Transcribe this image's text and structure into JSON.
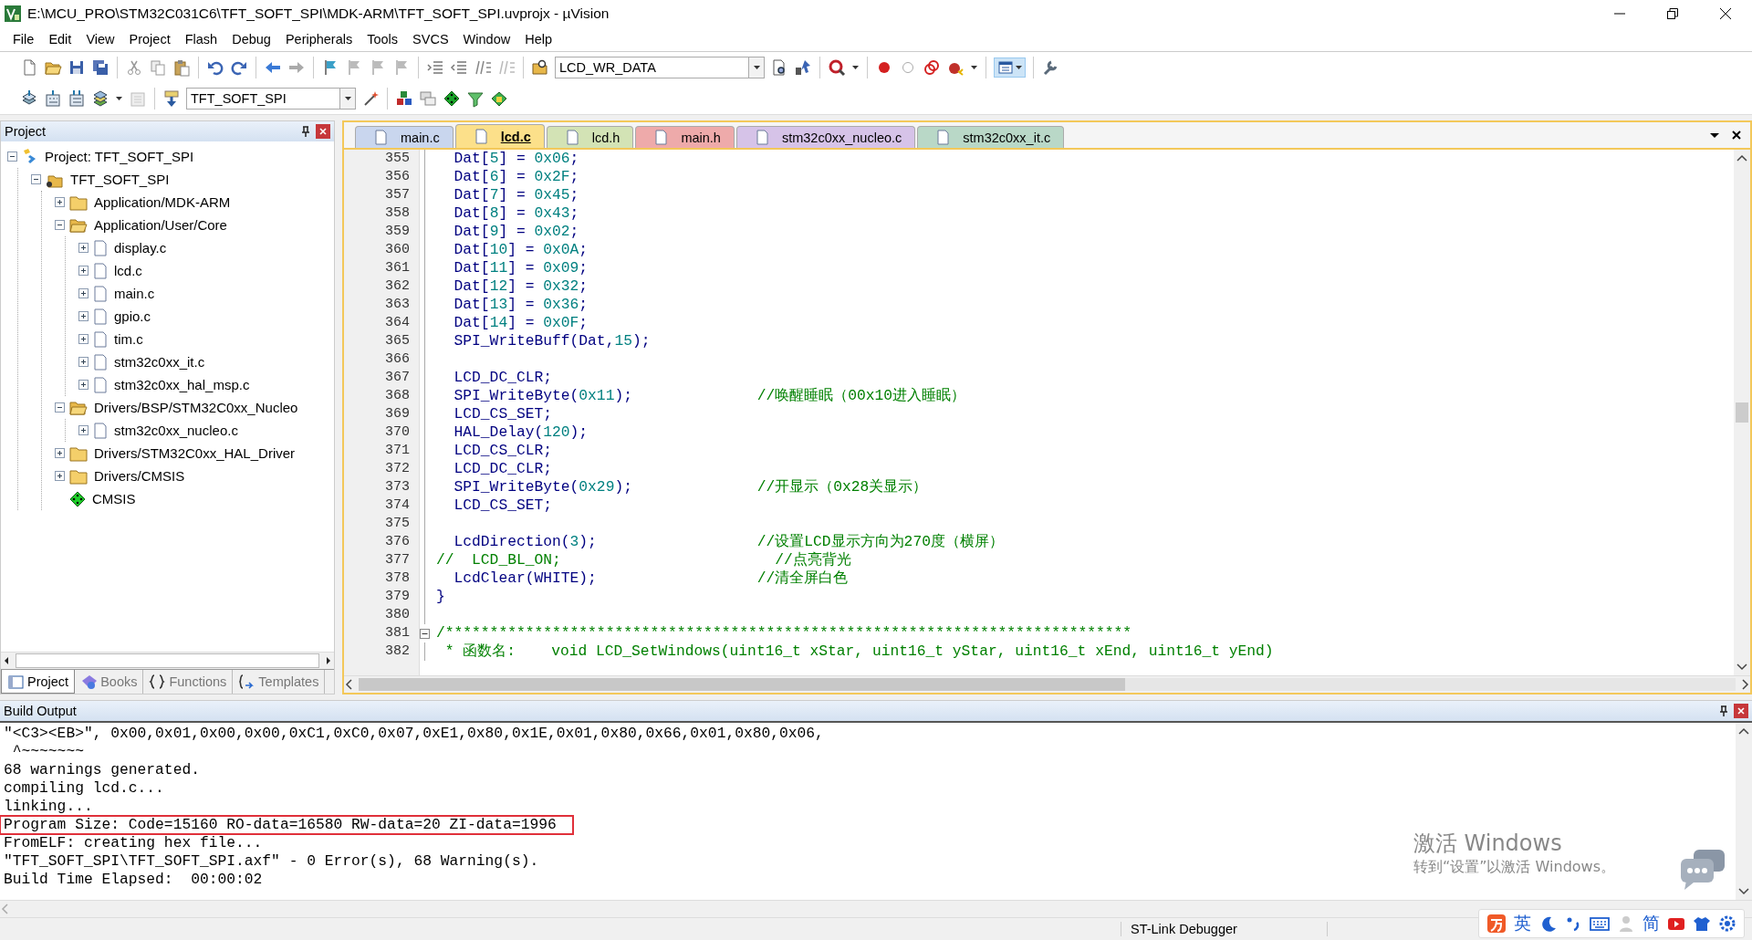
{
  "window": {
    "title": "E:\\MCU_PRO\\STM32C031C6\\TFT_SOFT_SPI\\MDK-ARM\\TFT_SOFT_SPI.uvprojx - µVision"
  },
  "menu": [
    "File",
    "Edit",
    "View",
    "Project",
    "Flash",
    "Debug",
    "Peripherals",
    "Tools",
    "SVCS",
    "Window",
    "Help"
  ],
  "toolbar": {
    "find_combo": "LCD_WR_DATA",
    "target_combo": "TFT_SOFT_SPI"
  },
  "project_panel": {
    "title": "Project",
    "tree": [
      {
        "label": "Project: TFT_SOFT_SPI",
        "kind": "project",
        "expanded": true,
        "children": [
          {
            "label": "TFT_SOFT_SPI",
            "kind": "target",
            "expanded": true,
            "children": [
              {
                "label": "Application/MDK-ARM",
                "kind": "folder",
                "expanded": false
              },
              {
                "label": "Application/User/Core",
                "kind": "folder",
                "expanded": true,
                "children": [
                  {
                    "label": "display.c",
                    "kind": "file",
                    "expanded": false
                  },
                  {
                    "label": "lcd.c",
                    "kind": "file",
                    "expanded": false
                  },
                  {
                    "label": "main.c",
                    "kind": "file",
                    "expanded": false
                  },
                  {
                    "label": "gpio.c",
                    "kind": "file",
                    "expanded": false
                  },
                  {
                    "label": "tim.c",
                    "kind": "file",
                    "expanded": false
                  },
                  {
                    "label": "stm32c0xx_it.c",
                    "kind": "file",
                    "expanded": false
                  },
                  {
                    "label": "stm32c0xx_hal_msp.c",
                    "kind": "file",
                    "expanded": false
                  }
                ]
              },
              {
                "label": "Drivers/BSP/STM32C0xx_Nucleo",
                "kind": "folder",
                "expanded": true,
                "children": [
                  {
                    "label": "stm32c0xx_nucleo.c",
                    "kind": "file",
                    "expanded": false
                  }
                ]
              },
              {
                "label": "Drivers/STM32C0xx_HAL_Driver",
                "kind": "folder",
                "expanded": false
              },
              {
                "label": "Drivers/CMSIS",
                "kind": "folder",
                "expanded": false
              },
              {
                "label": "CMSIS",
                "kind": "component"
              }
            ]
          }
        ]
      }
    ],
    "tabs": [
      {
        "label": "Project",
        "kind": "project",
        "selected": true
      },
      {
        "label": "Books",
        "kind": "books",
        "selected": false
      },
      {
        "label": "Functions",
        "kind": "functions",
        "selected": false
      },
      {
        "label": "Templates",
        "kind": "templates",
        "selected": false
      }
    ]
  },
  "editor_tabs": [
    {
      "label": "main.c",
      "color": "#c9d6ee",
      "selected": false
    },
    {
      "label": "lcd.c",
      "color": "#fce08a",
      "selected": true
    },
    {
      "label": "lcd.h",
      "color": "#d3e3b5",
      "selected": false
    },
    {
      "label": "main.h",
      "color": "#eeaaaa",
      "selected": false
    },
    {
      "label": "stm32c0xx_nucleo.c",
      "color": "#d6c3e8",
      "selected": false
    },
    {
      "label": "stm32c0xx_it.c",
      "color": "#b9d8c7",
      "selected": false
    }
  ],
  "code_lines": [
    {
      "number": "355",
      "segments": [
        {
          "kind": "plain",
          "text": "  Dat["
        },
        {
          "kind": "number",
          "text": "5"
        },
        {
          "kind": "plain",
          "text": "] = "
        },
        {
          "kind": "number",
          "text": "0x06"
        },
        {
          "kind": "plain",
          "text": ";"
        }
      ]
    },
    {
      "number": "356",
      "segments": [
        {
          "kind": "plain",
          "text": "  Dat["
        },
        {
          "kind": "number",
          "text": "6"
        },
        {
          "kind": "plain",
          "text": "] = "
        },
        {
          "kind": "number",
          "text": "0x2F"
        },
        {
          "kind": "plain",
          "text": ";"
        }
      ]
    },
    {
      "number": "357",
      "segments": [
        {
          "kind": "plain",
          "text": "  Dat["
        },
        {
          "kind": "number",
          "text": "7"
        },
        {
          "kind": "plain",
          "text": "] = "
        },
        {
          "kind": "number",
          "text": "0x45"
        },
        {
          "kind": "plain",
          "text": ";"
        }
      ]
    },
    {
      "number": "358",
      "segments": [
        {
          "kind": "plain",
          "text": "  Dat["
        },
        {
          "kind": "number",
          "text": "8"
        },
        {
          "kind": "plain",
          "text": "] = "
        },
        {
          "kind": "number",
          "text": "0x43"
        },
        {
          "kind": "plain",
          "text": ";"
        }
      ]
    },
    {
      "number": "359",
      "segments": [
        {
          "kind": "plain",
          "text": "  Dat["
        },
        {
          "kind": "number",
          "text": "9"
        },
        {
          "kind": "plain",
          "text": "] = "
        },
        {
          "kind": "number",
          "text": "0x02"
        },
        {
          "kind": "plain",
          "text": ";"
        }
      ]
    },
    {
      "number": "360",
      "segments": [
        {
          "kind": "plain",
          "text": "  Dat["
        },
        {
          "kind": "number",
          "text": "10"
        },
        {
          "kind": "plain",
          "text": "] = "
        },
        {
          "kind": "number",
          "text": "0x0A"
        },
        {
          "kind": "plain",
          "text": ";"
        }
      ]
    },
    {
      "number": "361",
      "segments": [
        {
          "kind": "plain",
          "text": "  Dat["
        },
        {
          "kind": "number",
          "text": "11"
        },
        {
          "kind": "plain",
          "text": "] = "
        },
        {
          "kind": "number",
          "text": "0x09"
        },
        {
          "kind": "plain",
          "text": ";"
        }
      ]
    },
    {
      "number": "362",
      "segments": [
        {
          "kind": "plain",
          "text": "  Dat["
        },
        {
          "kind": "number",
          "text": "12"
        },
        {
          "kind": "plain",
          "text": "] = "
        },
        {
          "kind": "number",
          "text": "0x32"
        },
        {
          "kind": "plain",
          "text": ";"
        }
      ]
    },
    {
      "number": "363",
      "segments": [
        {
          "kind": "plain",
          "text": "  Dat["
        },
        {
          "kind": "number",
          "text": "13"
        },
        {
          "kind": "plain",
          "text": "] = "
        },
        {
          "kind": "number",
          "text": "0x36"
        },
        {
          "kind": "plain",
          "text": ";"
        }
      ]
    },
    {
      "number": "364",
      "segments": [
        {
          "kind": "plain",
          "text": "  Dat["
        },
        {
          "kind": "number",
          "text": "14"
        },
        {
          "kind": "plain",
          "text": "] = "
        },
        {
          "kind": "number",
          "text": "0x0F"
        },
        {
          "kind": "plain",
          "text": ";"
        }
      ]
    },
    {
      "number": "365",
      "segments": [
        {
          "kind": "plain",
          "text": "  SPI_WriteBuff(Dat,"
        },
        {
          "kind": "number",
          "text": "15"
        },
        {
          "kind": "plain",
          "text": ");"
        }
      ]
    },
    {
      "number": "366"
    },
    {
      "number": "367",
      "segments": [
        {
          "kind": "plain",
          "text": "  LCD_DC_CLR;"
        }
      ]
    },
    {
      "number": "368",
      "segments": [
        {
          "kind": "plain",
          "text": "  SPI_WriteByte("
        },
        {
          "kind": "number",
          "text": "0x11"
        },
        {
          "kind": "plain",
          "text": ");              "
        },
        {
          "kind": "comment",
          "text": "//唤醒睡眠（00x10进入睡眠）"
        }
      ]
    },
    {
      "number": "369",
      "segments": [
        {
          "kind": "plain",
          "text": "  LCD_CS_SET;"
        }
      ]
    },
    {
      "number": "370",
      "segments": [
        {
          "kind": "plain",
          "text": "  HAL_Delay("
        },
        {
          "kind": "number",
          "text": "120"
        },
        {
          "kind": "plain",
          "text": ");"
        }
      ]
    },
    {
      "number": "371",
      "segments": [
        {
          "kind": "plain",
          "text": "  LCD_CS_CLR;"
        }
      ]
    },
    {
      "number": "372",
      "segments": [
        {
          "kind": "plain",
          "text": "  LCD_DC_CLR;"
        }
      ]
    },
    {
      "number": "373",
      "segments": [
        {
          "kind": "plain",
          "text": "  SPI_WriteByte("
        },
        {
          "kind": "number",
          "text": "0x29"
        },
        {
          "kind": "plain",
          "text": ");              "
        },
        {
          "kind": "comment",
          "text": "//开显示（0x28关显示）"
        }
      ]
    },
    {
      "number": "374",
      "segments": [
        {
          "kind": "plain",
          "text": "  LCD_CS_SET;"
        }
      ]
    },
    {
      "number": "375"
    },
    {
      "number": "376",
      "segments": [
        {
          "kind": "plain",
          "text": "  LcdDirection("
        },
        {
          "kind": "number",
          "text": "3"
        },
        {
          "kind": "plain",
          "text": ");                  "
        },
        {
          "kind": "comment",
          "text": "//设置LCD显示方向为270度（横屏）"
        }
      ]
    },
    {
      "number": "377",
      "segments": [
        {
          "kind": "comment",
          "text": "//  LCD_BL_ON;                        //点亮背光"
        }
      ]
    },
    {
      "number": "378",
      "segments": [
        {
          "kind": "plain",
          "text": "  LcdClear(WHITE);                  "
        },
        {
          "kind": "comment",
          "text": "//清全屏白色"
        }
      ]
    },
    {
      "number": "379",
      "segments": [
        {
          "kind": "plain",
          "text": "}"
        }
      ]
    },
    {
      "number": "380"
    },
    {
      "number": "381",
      "fold": true,
      "segments": [
        {
          "kind": "comment",
          "text": "/*****************************************************************************"
        }
      ]
    },
    {
      "number": "382",
      "segments": [
        {
          "kind": "comment",
          "text": " * 函数名:    void LCD_SetWindows(uint16_t xStar, uint16_t yStar, uint16_t xEnd, uint16_t yEnd)"
        }
      ]
    }
  ],
  "build_output": {
    "title": "Build Output",
    "lines": [
      {
        "text": "\"<C3><EB>\", 0x00,0x01,0x00,0x00,0xC1,0xC0,0x07,0xE1,0x80,0x1E,0x01,0x80,0x66,0x01,0x80,0x06,",
        "highlighted": false
      },
      {
        "text": " ^~~~~~~~",
        "highlighted": false
      },
      {
        "text": "68 warnings generated.",
        "highlighted": false
      },
      {
        "text": "compiling lcd.c...",
        "highlighted": false
      },
      {
        "text": "linking...",
        "highlighted": false
      },
      {
        "text": "Program Size: Code=15160 RO-data=16580 RW-data=20 ZI-data=1996",
        "highlighted": true
      },
      {
        "text": "FromELF: creating hex file...",
        "highlighted": false
      },
      {
        "text": "\"TFT_SOFT_SPI\\TFT_SOFT_SPI.axf\" - 0 Error(s), 68 Warning(s).",
        "highlighted": false
      },
      {
        "text": "Build Time Elapsed:  00:00:02",
        "highlighted": false
      }
    ]
  },
  "activation_notice": {
    "title": "激活 Windows",
    "message": "转到“设置”以激活 Windows。"
  },
  "ime_toolbar": {
    "language": "英",
    "script": "简"
  },
  "status_bar": {
    "debugger": "ST-Link Debugger"
  }
}
